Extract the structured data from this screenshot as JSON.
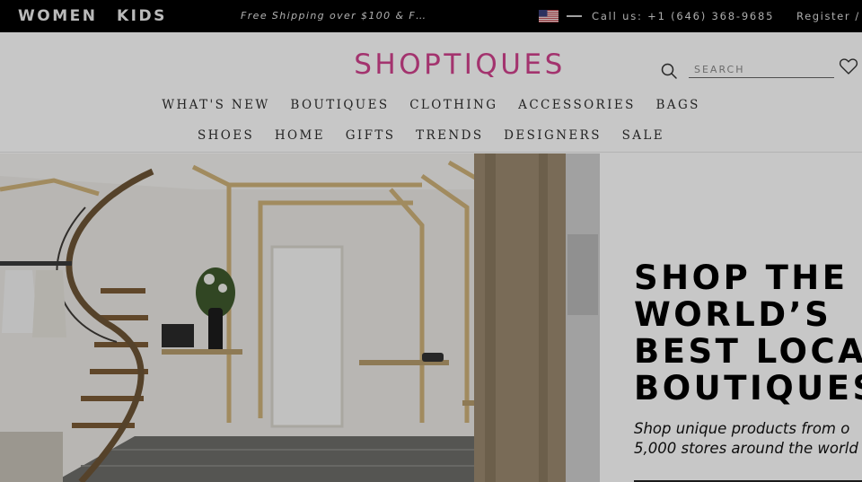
{
  "topbar": {
    "women": "WOMEN",
    "kids": "KIDS",
    "shipping": "Free Shipping over $100 & F…",
    "flag_icon": "us-flag-icon",
    "call": "Call us: +1 (646) 368-9685",
    "register": "Register /"
  },
  "header": {
    "logo": "SHOPTIQUES",
    "logo_color": "#d1428e",
    "search_placeholder": "SEARCH",
    "search_icon": "search-icon",
    "wishlist_icon": "heart-icon"
  },
  "nav": {
    "row1": [
      "WHAT'S NEW",
      "BOUTIQUES",
      "CLOTHING",
      "ACCESSORIES",
      "BAGS"
    ],
    "row2": [
      "SHOES",
      "HOME",
      "GIFTS",
      "TRENDS",
      "DESIGNERS",
      "SALE"
    ]
  },
  "hero": {
    "title_lines": [
      "SHOP THE",
      "WORLD’S",
      "BEST LOCA",
      "BOUTIQUES"
    ],
    "subtitle_lines": [
      "Shop unique products from o",
      "5,000 stores around the world"
    ]
  }
}
